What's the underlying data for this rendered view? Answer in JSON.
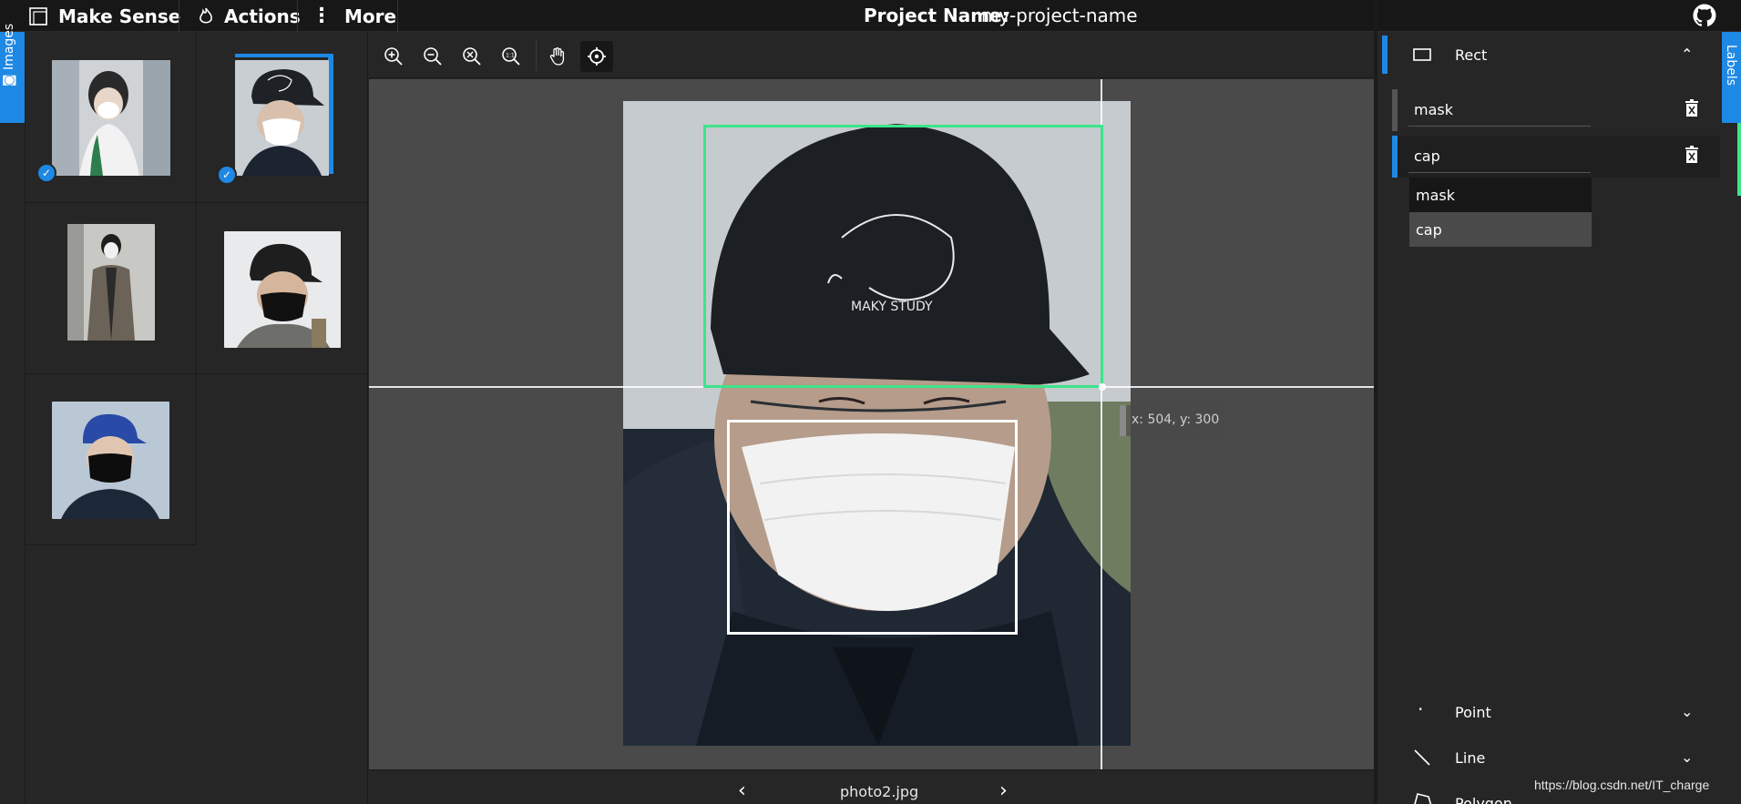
{
  "topbar": {
    "brand": "Make Sense",
    "actions": "Actions",
    "more": "More",
    "project_label": "Project Name:",
    "project_value": "my-project-name"
  },
  "sidebar_left": {
    "tab_label": "Images",
    "thumbnails": [
      {
        "name": "thumb-1",
        "checked": true,
        "selected": false
      },
      {
        "name": "thumb-2",
        "checked": true,
        "selected": true
      },
      {
        "name": "thumb-3",
        "checked": false,
        "selected": false
      },
      {
        "name": "thumb-4",
        "checked": false,
        "selected": false
      },
      {
        "name": "thumb-5",
        "checked": false,
        "selected": false
      }
    ]
  },
  "editor": {
    "tools": [
      "zoom-in-icon",
      "zoom-out-icon",
      "zoom-fit-icon",
      "zoom-actual-icon",
      "pan-hand-icon",
      "crosshair-icon"
    ],
    "coord_text": "x: 504, y: 300",
    "filename": "photo2.jpg",
    "prev": "‹",
    "next": "›"
  },
  "labels_panel": {
    "tab_label": "Labels",
    "sections": {
      "rect": "Rect",
      "point": "Point",
      "line": "Line",
      "polygon": "Polygon"
    },
    "label_rows": [
      "mask",
      "cap"
    ],
    "dropdown_options": [
      "mask",
      "cap"
    ]
  },
  "colors": {
    "accent": "#1e88e5",
    "bbox_active": "#3de48a",
    "bbox_inactive": "#ffffff",
    "canvas_bg": "#4a4a4a"
  },
  "watermark": "https://blog.csdn.net/IT_charge"
}
